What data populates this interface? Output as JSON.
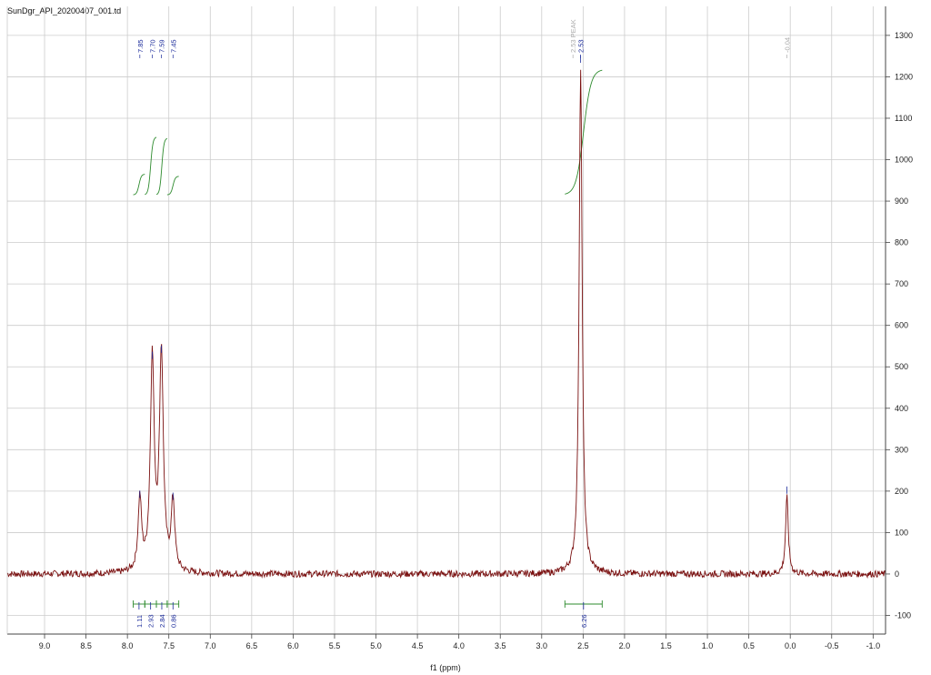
{
  "document": {
    "filename": "SunDgr_API_20200407_001.td"
  },
  "chart_data": {
    "type": "line",
    "title": "",
    "xlabel": "f1 (ppm)",
    "ylabel": "",
    "xlim": [
      9.45,
      -1.15
    ],
    "ylim": [
      -145,
      1370
    ],
    "x_reversed": true,
    "grid": true,
    "x_ticks": [
      9.0,
      8.5,
      8.0,
      7.5,
      7.0,
      6.5,
      6.0,
      5.5,
      5.0,
      4.5,
      4.0,
      3.5,
      3.0,
      2.5,
      2.0,
      1.5,
      1.0,
      0.5,
      0.0,
      -0.5,
      -1.0
    ],
    "x_tick_labels": [
      "9.0",
      "8.5",
      "8.0",
      "7.5",
      "7.0",
      "6.5",
      "6.0",
      "5.5",
      "5.0",
      "4.5",
      "4.0",
      "3.5",
      "3.0",
      "2.5",
      "2.0",
      "1.5",
      "1.0",
      "0.5",
      "0.0",
      "-0.5",
      "-1.0"
    ],
    "y_ticks": [
      -100,
      0,
      100,
      200,
      300,
      400,
      500,
      600,
      700,
      800,
      900,
      1000,
      1100,
      1200,
      1300
    ],
    "y_tick_labels": [
      "-100",
      "0",
      "100",
      "200",
      "300",
      "400",
      "500",
      "600",
      "700",
      "800",
      "900",
      "1000",
      "1100",
      "1200",
      "1300"
    ],
    "colors": {
      "spectrum": "#7a1010",
      "integral": "#2e8b2e",
      "peak_label": "#1a2a9a",
      "grid": "#cccccc"
    },
    "series": [
      {
        "type": "spectrum",
        "peaks": [
          {
            "ppm": 7.85,
            "height": 175,
            "width": 0.025
          },
          {
            "ppm": 7.7,
            "height": 510,
            "width": 0.028
          },
          {
            "ppm": 7.59,
            "height": 525,
            "width": 0.028
          },
          {
            "ppm": 7.45,
            "height": 170,
            "width": 0.025
          },
          {
            "ppm": 2.53,
            "height": 1225,
            "width": 0.022
          },
          {
            "ppm": 0.04,
            "height": 185,
            "width": 0.02
          }
        ],
        "noise_amplitude": 8
      }
    ],
    "peak_labels": [
      {
        "text": "7.85",
        "ppm": 7.85,
        "style": "normal"
      },
      {
        "text": "7.70",
        "ppm": 7.7,
        "style": "normal"
      },
      {
        "text": "7.59",
        "ppm": 7.59,
        "style": "normal"
      },
      {
        "text": "7.45",
        "ppm": 7.45,
        "style": "normal"
      },
      {
        "text": "2.53 PEAK",
        "ppm": 2.535,
        "style": "grey"
      },
      {
        "text": "2.53",
        "ppm": 2.53,
        "style": "normal"
      },
      {
        "text": "-0.04",
        "ppm": 0.04,
        "style": "grey"
      }
    ],
    "integrals": [
      {
        "from": 7.93,
        "to": 7.79,
        "value": "1.11"
      },
      {
        "from": 7.79,
        "to": 7.65,
        "value": "2.93"
      },
      {
        "from": 7.65,
        "to": 7.52,
        "value": "2.84"
      },
      {
        "from": 7.52,
        "to": 7.38,
        "value": "0.86"
      },
      {
        "from": 2.72,
        "to": 2.27,
        "value": "6.26"
      }
    ],
    "integral_curves": [
      {
        "from": 7.93,
        "to": 7.79,
        "y_start": 915,
        "y_end": 965
      },
      {
        "from": 7.79,
        "to": 7.65,
        "y_start": 915,
        "y_end": 1055
      },
      {
        "from": 7.65,
        "to": 7.52,
        "y_start": 915,
        "y_end": 1052
      },
      {
        "from": 7.52,
        "to": 7.38,
        "y_start": 915,
        "y_end": 960
      },
      {
        "from": 2.72,
        "to": 2.27,
        "y_start": 915,
        "y_end": 1218
      }
    ]
  }
}
